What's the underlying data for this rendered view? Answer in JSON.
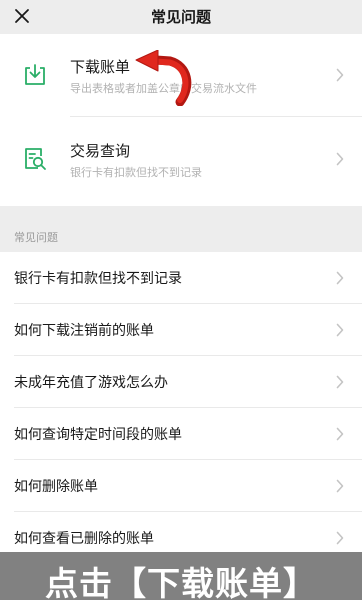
{
  "nav": {
    "title": "常见问题"
  },
  "services": [
    {
      "title": "下载账单",
      "subtitle": "导出表格或者加盖公章的交易流水文件",
      "icon": "download-tray-icon"
    },
    {
      "title": "交易查询",
      "subtitle": "银行卡有扣款但找不到记录",
      "icon": "document-search-icon"
    }
  ],
  "faq": {
    "heading": "常见问题",
    "items": [
      "银行卡有扣款但找不到记录",
      "如何下载注销前的账单",
      "未成年充值了游戏怎么办",
      "如何查询特定时间段的账单",
      "如何删除账单",
      "如何查看已删除的账单"
    ]
  },
  "caption": "点击【下载账单】",
  "colors": {
    "accent": "#2aae67",
    "arrow": "#d8251c",
    "background": "#ededed"
  }
}
